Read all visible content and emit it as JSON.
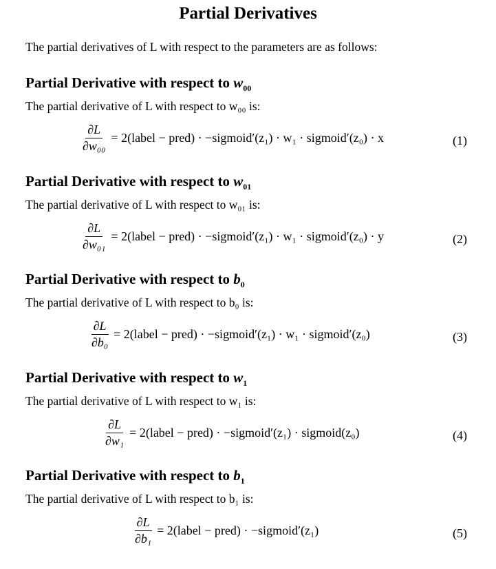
{
  "title": "Partial Derivatives",
  "intro": "The partial derivatives of L with respect to the parameters are as follows:",
  "sections": [
    {
      "heading": "Partial Derivative with respect to",
      "var": "w",
      "sub": "00",
      "text": "The partial derivative of L with respect to w₀₀ is:",
      "num": "∂L",
      "den": "∂w₀₀",
      "rhs": "= 2(label − pred) · −sigmoid′(z₁) · w₁ · sigmoid′(z₀) · x",
      "no": "(1)"
    },
    {
      "heading": "Partial Derivative with respect to",
      "var": "w",
      "sub": "01",
      "text": "The partial derivative of L with respect to w₀₁ is:",
      "num": "∂L",
      "den": "∂w₀₁",
      "rhs": "= 2(label − pred) · −sigmoid′(z₁) · w₁ · sigmoid′(z₀) · y",
      "no": "(2)"
    },
    {
      "heading": "Partial Derivative with respect to",
      "var": "b",
      "sub": "0",
      "text": "The partial derivative of L with respect to b₀ is:",
      "num": "∂L",
      "den": "∂b₀",
      "rhs": "= 2(label − pred) · −sigmoid′(z₁) · w₁ · sigmoid′(z₀)",
      "no": "(3)"
    },
    {
      "heading": "Partial Derivative with respect to",
      "var": "w",
      "sub": "1",
      "text": "The partial derivative of L with respect to w₁ is:",
      "num": "∂L",
      "den": "∂w₁",
      "rhs": "= 2(label − pred) · −sigmoid′(z₁) · sigmoid(z₀)",
      "no": "(4)"
    },
    {
      "heading": "Partial Derivative with respect to",
      "var": "b",
      "sub": "1",
      "text": "The partial derivative of L with respect to b₁ is:",
      "num": "∂L",
      "den": "∂b₁",
      "rhs": "= 2(label − pred) · −sigmoid′(z₁)",
      "no": "(5)"
    }
  ]
}
